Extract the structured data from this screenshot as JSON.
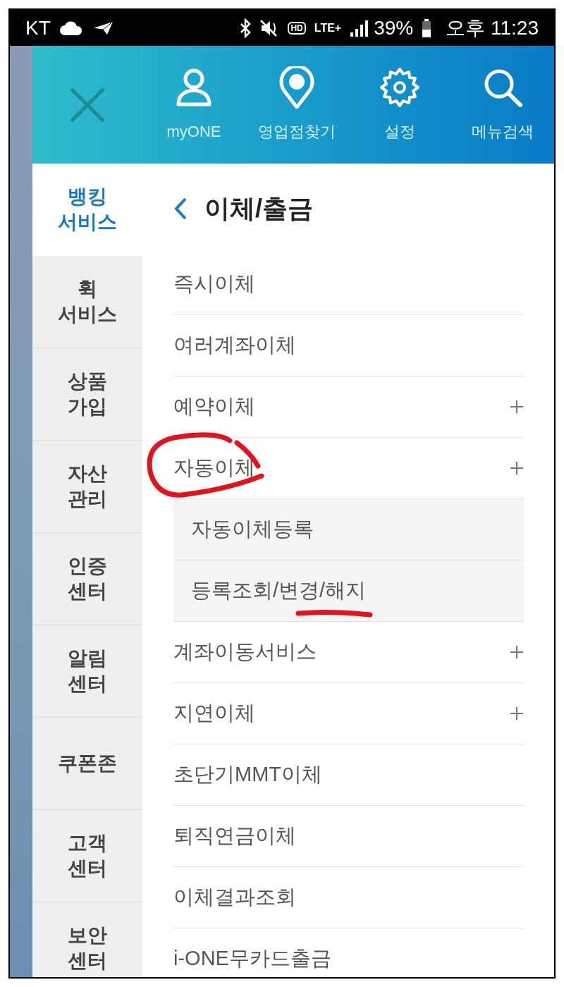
{
  "status_bar": {
    "carrier": "KT",
    "network_labels": [
      "HD",
      "LTE+"
    ],
    "battery": "39%",
    "time": "오후 11:23"
  },
  "header": {
    "actions": [
      {
        "kind": "person",
        "label": "myONE"
      },
      {
        "kind": "pin",
        "label": "영업점찾기"
      },
      {
        "kind": "gear",
        "label": "설정"
      },
      {
        "kind": "search",
        "label": "메뉴검색"
      }
    ]
  },
  "sidebar": {
    "items": [
      {
        "label": "뱅킹\n서비스",
        "selected": true
      },
      {
        "label": "휙\n서비스",
        "selected": false
      },
      {
        "label": "상품\n가입",
        "selected": false
      },
      {
        "label": "자산\n관리",
        "selected": false
      },
      {
        "label": "인증\n센터",
        "selected": false
      },
      {
        "label": "알림\n센터",
        "selected": false
      },
      {
        "label": "쿠폰존",
        "selected": false
      },
      {
        "label": "고객\n센터",
        "selected": false
      },
      {
        "label": "보안\n센터",
        "selected": false
      }
    ]
  },
  "section": {
    "title": "이체/출금",
    "items": [
      {
        "label": "즉시이체",
        "expandable": false
      },
      {
        "label": "여러계좌이체",
        "expandable": false
      },
      {
        "label": "예약이체",
        "expandable": true
      },
      {
        "label": "자동이체",
        "expandable": true,
        "circled": true,
        "children": [
          {
            "label": "자동이체등록"
          },
          {
            "label": "등록조회/변경/해지",
            "underlined": true
          }
        ]
      },
      {
        "label": "계좌이동서비스",
        "expandable": true
      },
      {
        "label": "지연이체",
        "expandable": true
      },
      {
        "label": "초단기MMT이체",
        "expandable": false
      },
      {
        "label": "퇴직연금이체",
        "expandable": false
      },
      {
        "label": "이체결과조회",
        "expandable": false
      },
      {
        "label": "i-ONE무카드출금",
        "expandable": false
      }
    ]
  }
}
